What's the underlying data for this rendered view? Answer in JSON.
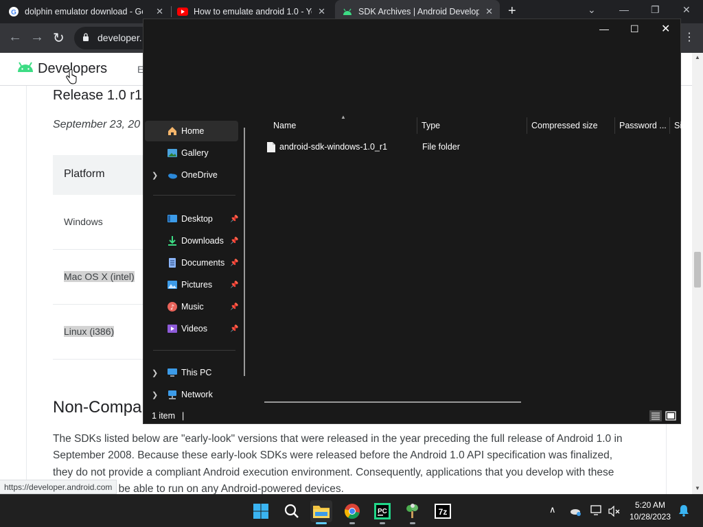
{
  "browser": {
    "tabs": [
      {
        "title": "dolphin emulator download - Go",
        "icon": "google-icon"
      },
      {
        "title": "How to emulate android 1.0 - Yo",
        "icon": "youtube-icon"
      },
      {
        "title": "SDK Archives  |  Android Develop",
        "icon": "android-icon"
      }
    ],
    "new_tab": "+",
    "address": "developer.",
    "status_url": "https://developer.android.com"
  },
  "site": {
    "logo_text": "Developers",
    "nav_next": "E",
    "release_title": "Release 1.0 r1",
    "release_date": "September 23, 20",
    "table_header": "Platform",
    "platforms": [
      "Windows",
      "Mac OS X (intel)",
      "Linux (i386)"
    ],
    "section_title": "Non-Compa",
    "paragraph": "The SDKs listed below are \"early-look\" versions that were released in the year preceding the full release of Android 1.0 in September 2008. Because these early-look SDKs were released before the Android 1.0 API specification was finalized, they do not provide a compliant Android execution environment. Consequently, applications that you develop with these SDKs will not be able to run on any Android-powered devices."
  },
  "explorer": {
    "nav_items": {
      "home": "Home",
      "gallery": "Gallery",
      "onedrive": "OneDrive",
      "desktop": "Desktop",
      "downloads": "Downloads",
      "documents": "Documents",
      "pictures": "Pictures",
      "music": "Music",
      "videos": "Videos",
      "this_pc": "This PC",
      "network": "Network"
    },
    "columns": [
      "Name",
      "Type",
      "Compressed size",
      "Password ...",
      "Si"
    ],
    "files": [
      {
        "name": "android-sdk-windows-1.0_r1",
        "type": "File folder"
      }
    ],
    "status": "1 item"
  },
  "taskbar": {
    "time": "5:20 AM",
    "date": "10/28/2023"
  },
  "colors": {
    "chrome_dark": "#202124",
    "explorer_bg": "#191919",
    "android_green": "#3ddc84",
    "taskbar_bg": "#202020"
  }
}
